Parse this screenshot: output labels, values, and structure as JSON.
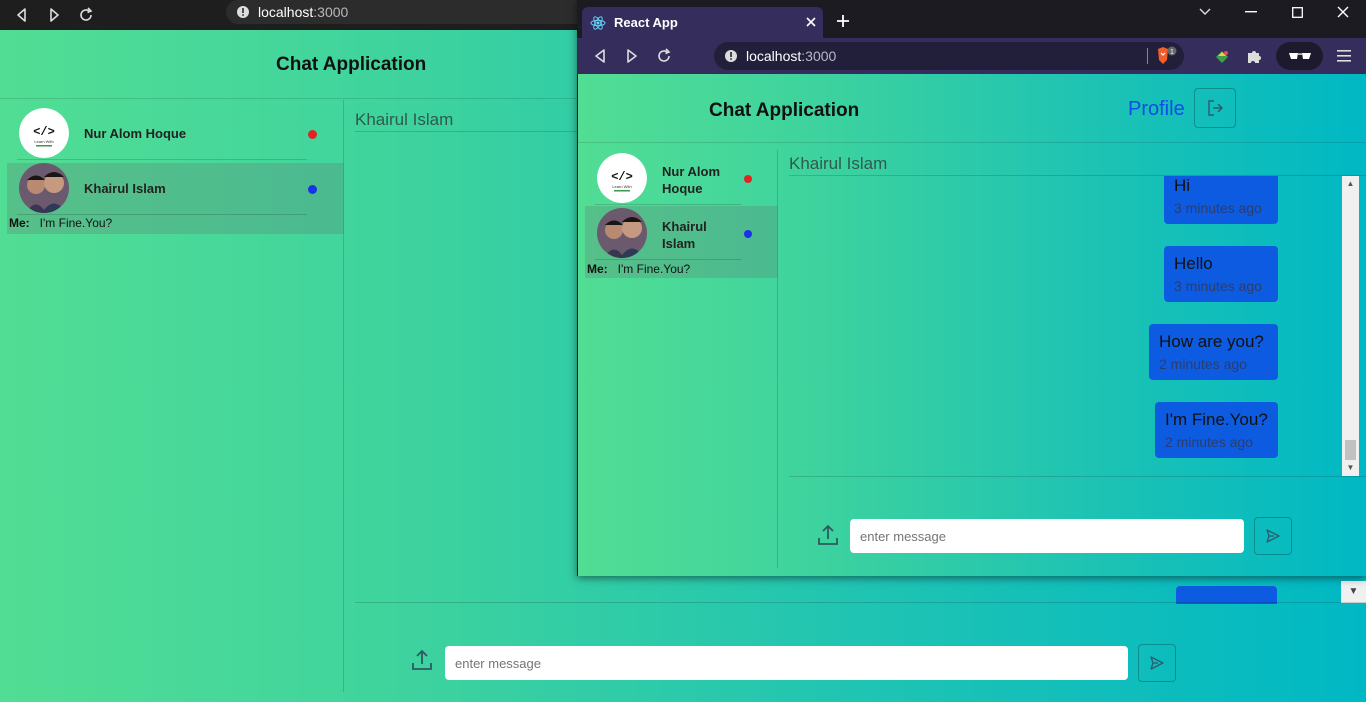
{
  "background_browser": {
    "url_host": "localhost",
    "url_port": ":3000"
  },
  "background_app": {
    "title": "Chat Application",
    "contacts": [
      {
        "name": "Nur Alom Hoque",
        "status_color": "#e02424"
      },
      {
        "name": "Khairul Islam",
        "status_color": "#1a32e6"
      }
    ],
    "last_message": {
      "sender": "Me:",
      "text": "I'm Fine.You?"
    },
    "chat_partner": "Khairul Islam",
    "input_placeholder": "enter message"
  },
  "browser": {
    "tab_title": "React App",
    "url_host": "localhost",
    "url_port": ":3000",
    "shields_badge": "1"
  },
  "app": {
    "title": "Chat Application",
    "profile_label": "Profile",
    "contacts": [
      {
        "name": "Nur Alom Hoque",
        "status_color": "#e02424"
      },
      {
        "name": "Khairul Islam",
        "status_color": "#1a32e6"
      }
    ],
    "last_message": {
      "sender": "Me:",
      "text": "I'm Fine.You?"
    },
    "chat_partner": "Khairul Islam",
    "messages": [
      {
        "text": "Hi",
        "time": "3 minutes ago"
      },
      {
        "text": "Hello",
        "time": "3 minutes ago"
      },
      {
        "text": "How are you?",
        "time": "2 minutes ago"
      },
      {
        "text": "I'm Fine.You?",
        "time": "2 minutes ago"
      }
    ],
    "input_placeholder": "enter message"
  },
  "colors": {
    "accent_blue": "#0d5be1",
    "gradient_start": "#52dd94",
    "gradient_end": "#00b8c4",
    "browser_purple": "#352e5c"
  }
}
